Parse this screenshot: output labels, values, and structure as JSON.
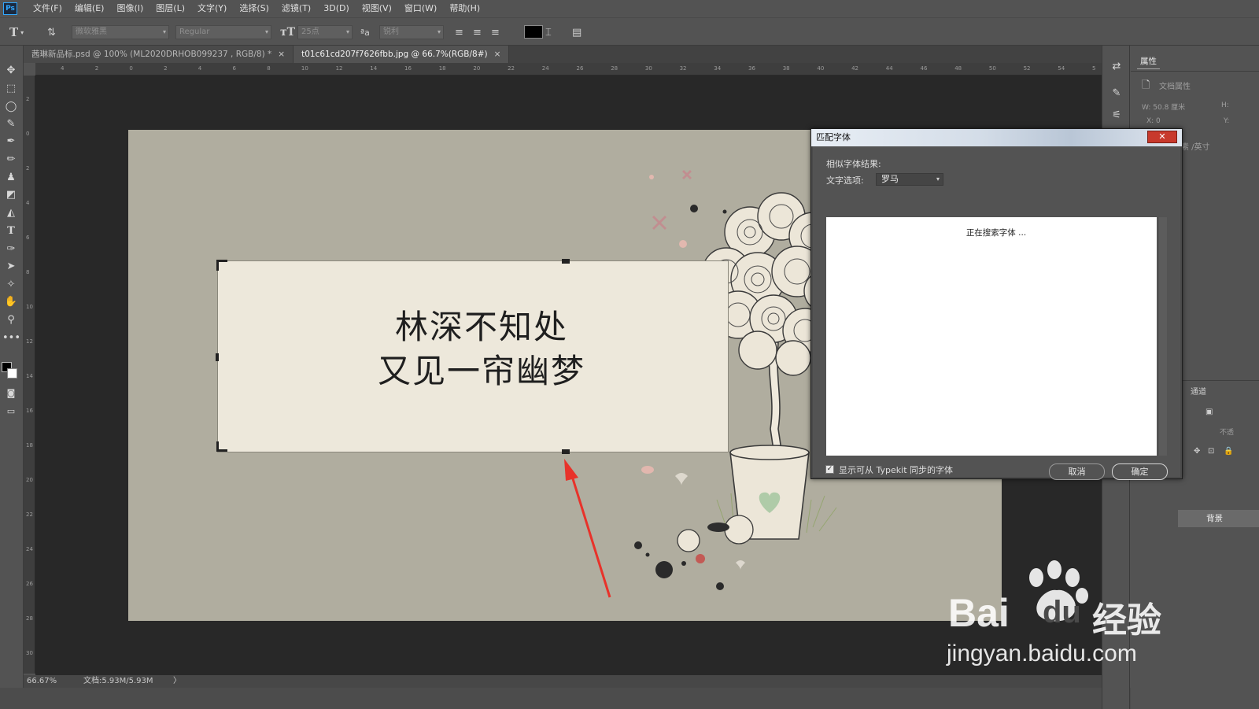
{
  "app": {
    "logo": "Ps"
  },
  "menu": [
    "文件(F)",
    "编辑(E)",
    "图像(I)",
    "图层(L)",
    "文字(Y)",
    "选择(S)",
    "滤镜(T)",
    "3D(D)",
    "视图(V)",
    "窗口(W)",
    "帮助(H)"
  ],
  "options": {
    "font_family": "微软雅黑",
    "font_style": "Regular",
    "font_size": "25点",
    "antialias": "锐利",
    "text_color": "#000000"
  },
  "tabs": [
    {
      "label": "茜琳新品标.psd @ 100% (ML2020DRHOB099237 , RGB/8) *",
      "close": "×"
    },
    {
      "label": "t01c61cd207f7626fbb.jpg @ 66.7%(RGB/8#)",
      "close": "×"
    }
  ],
  "ruler": {
    "h_ticks": [
      "4",
      "2",
      "0",
      "2",
      "4",
      "6",
      "8",
      "10",
      "12",
      "14",
      "16",
      "18",
      "20",
      "22",
      "24",
      "26",
      "28",
      "30",
      "32",
      "34",
      "36",
      "38",
      "40",
      "42",
      "44",
      "46",
      "48",
      "50",
      "52",
      "54",
      "5"
    ],
    "v_ticks": [
      "2",
      "0",
      "2",
      "4",
      "6",
      "8",
      "10",
      "12",
      "14",
      "16",
      "18",
      "20",
      "22",
      "24",
      "26",
      "28",
      "30"
    ]
  },
  "canvas": {
    "line1": "林深不知处",
    "line2": "又见一帘幽梦"
  },
  "status": {
    "zoom": "66.67%",
    "doc": "文档:5.93M/5.93M",
    "arrow": "〉"
  },
  "properties": {
    "tab": "属性",
    "doc_props": "文档属性",
    "w_label": "W: 50.8 厘米",
    "h_label": "H:",
    "x_label": "X: 0",
    "y_label": "Y:",
    "unit_label": "素 /英寸",
    "channels_tab": "通道",
    "opacity_label": "不透",
    "layer_name": "背景"
  },
  "dialog": {
    "title": "匹配字体",
    "close": "✕",
    "similar_label": "相似字体结果:",
    "text_option_label": "文字选项:",
    "text_option_value": "罗马",
    "searching": "正在搜索字体 ...",
    "checkbox_label": "显示可从 Typekit 同步的字体",
    "checked": true,
    "cancel": "取消",
    "ok": "确定"
  },
  "watermark": {
    "brand_a": "Bai",
    "brand_b": "du",
    "brand_c": "经验",
    "url": "jingyan.baidu.com"
  }
}
